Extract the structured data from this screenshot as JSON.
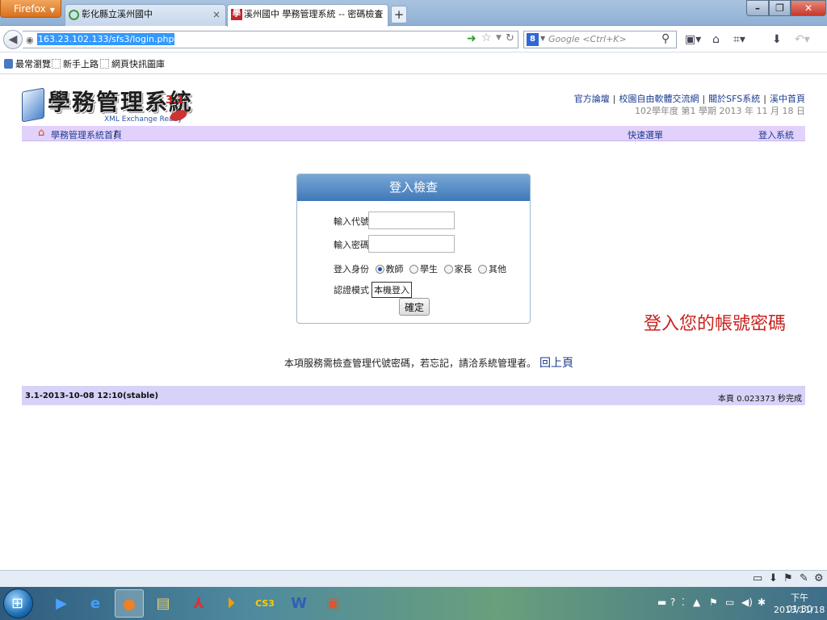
{
  "browser": {
    "menu_label": "Firefox",
    "tabs": [
      {
        "title": "彰化縣立溪州國中"
      },
      {
        "title": "溪州國中 學務管理系統 -- 密碼檢查"
      }
    ],
    "url": "163.23.102.133/sfs3/login.php",
    "search_placeholder": "Google <Ctrl+K>",
    "search_engine_glyph": "8",
    "bookmarks": [
      "最常瀏覽",
      "新手上路",
      "網頁快訊圖庫"
    ]
  },
  "page": {
    "logo": {
      "title": "學務管理系統",
      "version": "3.1",
      "subtitle": "XML Exchange Ready"
    },
    "top_links": [
      "官方論壇",
      "校園自由軟體交流網",
      "關於SFS系統",
      "溪中首頁"
    ],
    "date_line": "102學年度 第1 學期 2013 年 11 月 18 日",
    "breadcrumb": {
      "home": "學務管理系統首頁",
      "slash": "/"
    },
    "quick_menu": "快速選單",
    "login_link": "登入系統",
    "login_box": {
      "title": "登入檢查",
      "id_label": "輸入代號",
      "pw_label": "輸入密碼",
      "role_label": "登入身份",
      "roles": [
        "教師",
        "學生",
        "家長",
        "其他"
      ],
      "selected_role": "教師",
      "auth_label": "認證模式",
      "auth_value": "本機登入",
      "submit": "確定"
    },
    "hint": "登入您的帳號密碼",
    "notice": "本項服務需檢查管理代號密碼，若忘記，請洽系統管理者。",
    "back_link": "回上頁",
    "footer": {
      "version": "3.1-2013-10-08 12:10(stable)",
      "timing": "本頁 0.023373 秒完成"
    }
  },
  "taskbar": {
    "apps": [
      "windows-media-player",
      "internet-explorer",
      "firefox",
      "file-explorer",
      "acrobat",
      "premiere",
      "photoshop-cs3",
      "word",
      "pdf-editor"
    ],
    "clock_time": "下午 01:30",
    "clock_date": "2013/11/18"
  },
  "colors": {
    "accent_red": "#c8231f",
    "menubar": "#e2d2fb",
    "footer": "#d7d2f8",
    "login_head": "#3f78b8"
  }
}
